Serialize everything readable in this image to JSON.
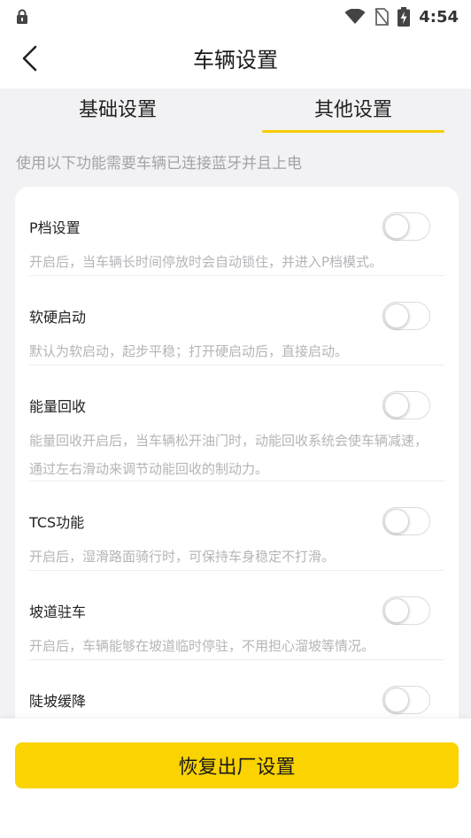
{
  "status_bar": {
    "time": "4:54",
    "icons": [
      "lock-icon",
      "wifi-icon",
      "sim-card-icon",
      "battery-charging-icon"
    ]
  },
  "header": {
    "title": "车辆设置",
    "back_icon": "chevron-left-icon"
  },
  "tabs": [
    {
      "label": "基础设置",
      "active": false
    },
    {
      "label": "其他设置",
      "active": true
    }
  ],
  "hint": "使用以下功能需要车辆已连接蓝牙并且上电",
  "settings": [
    {
      "title": "P档设置",
      "desc": "开启后，当车辆长时间停放时会自动锁住，并进入P档模式。",
      "enabled": false
    },
    {
      "title": "软硬启动",
      "desc": "默认为软启动，起步平稳；打开硬启动后，直接启动。",
      "enabled": false
    },
    {
      "title": "能量回收",
      "desc": "能量回收开启后，当车辆松开油门时，动能回收系统会使车辆减速，通过左右滑动来调节动能回收的制动力。",
      "enabled": false
    },
    {
      "title": "TCS功能",
      "desc": "开启后，湿滑路面骑行时，可保持车身稳定不打滑。",
      "enabled": false
    },
    {
      "title": "坡道驻车",
      "desc": "开启后，车辆能够在坡道临时停驻，不用担心溜坡等情况。",
      "enabled": false
    },
    {
      "title": "陡坡缓降",
      "desc": "",
      "enabled": false
    }
  ],
  "reset_button": "恢复出厂设置",
  "colors": {
    "accent": "#fad300",
    "tab_underline": "#f6cc00",
    "background": "#f2f2f4",
    "hint_text": "#a3a3a8",
    "desc_text": "#b5b5b9"
  }
}
